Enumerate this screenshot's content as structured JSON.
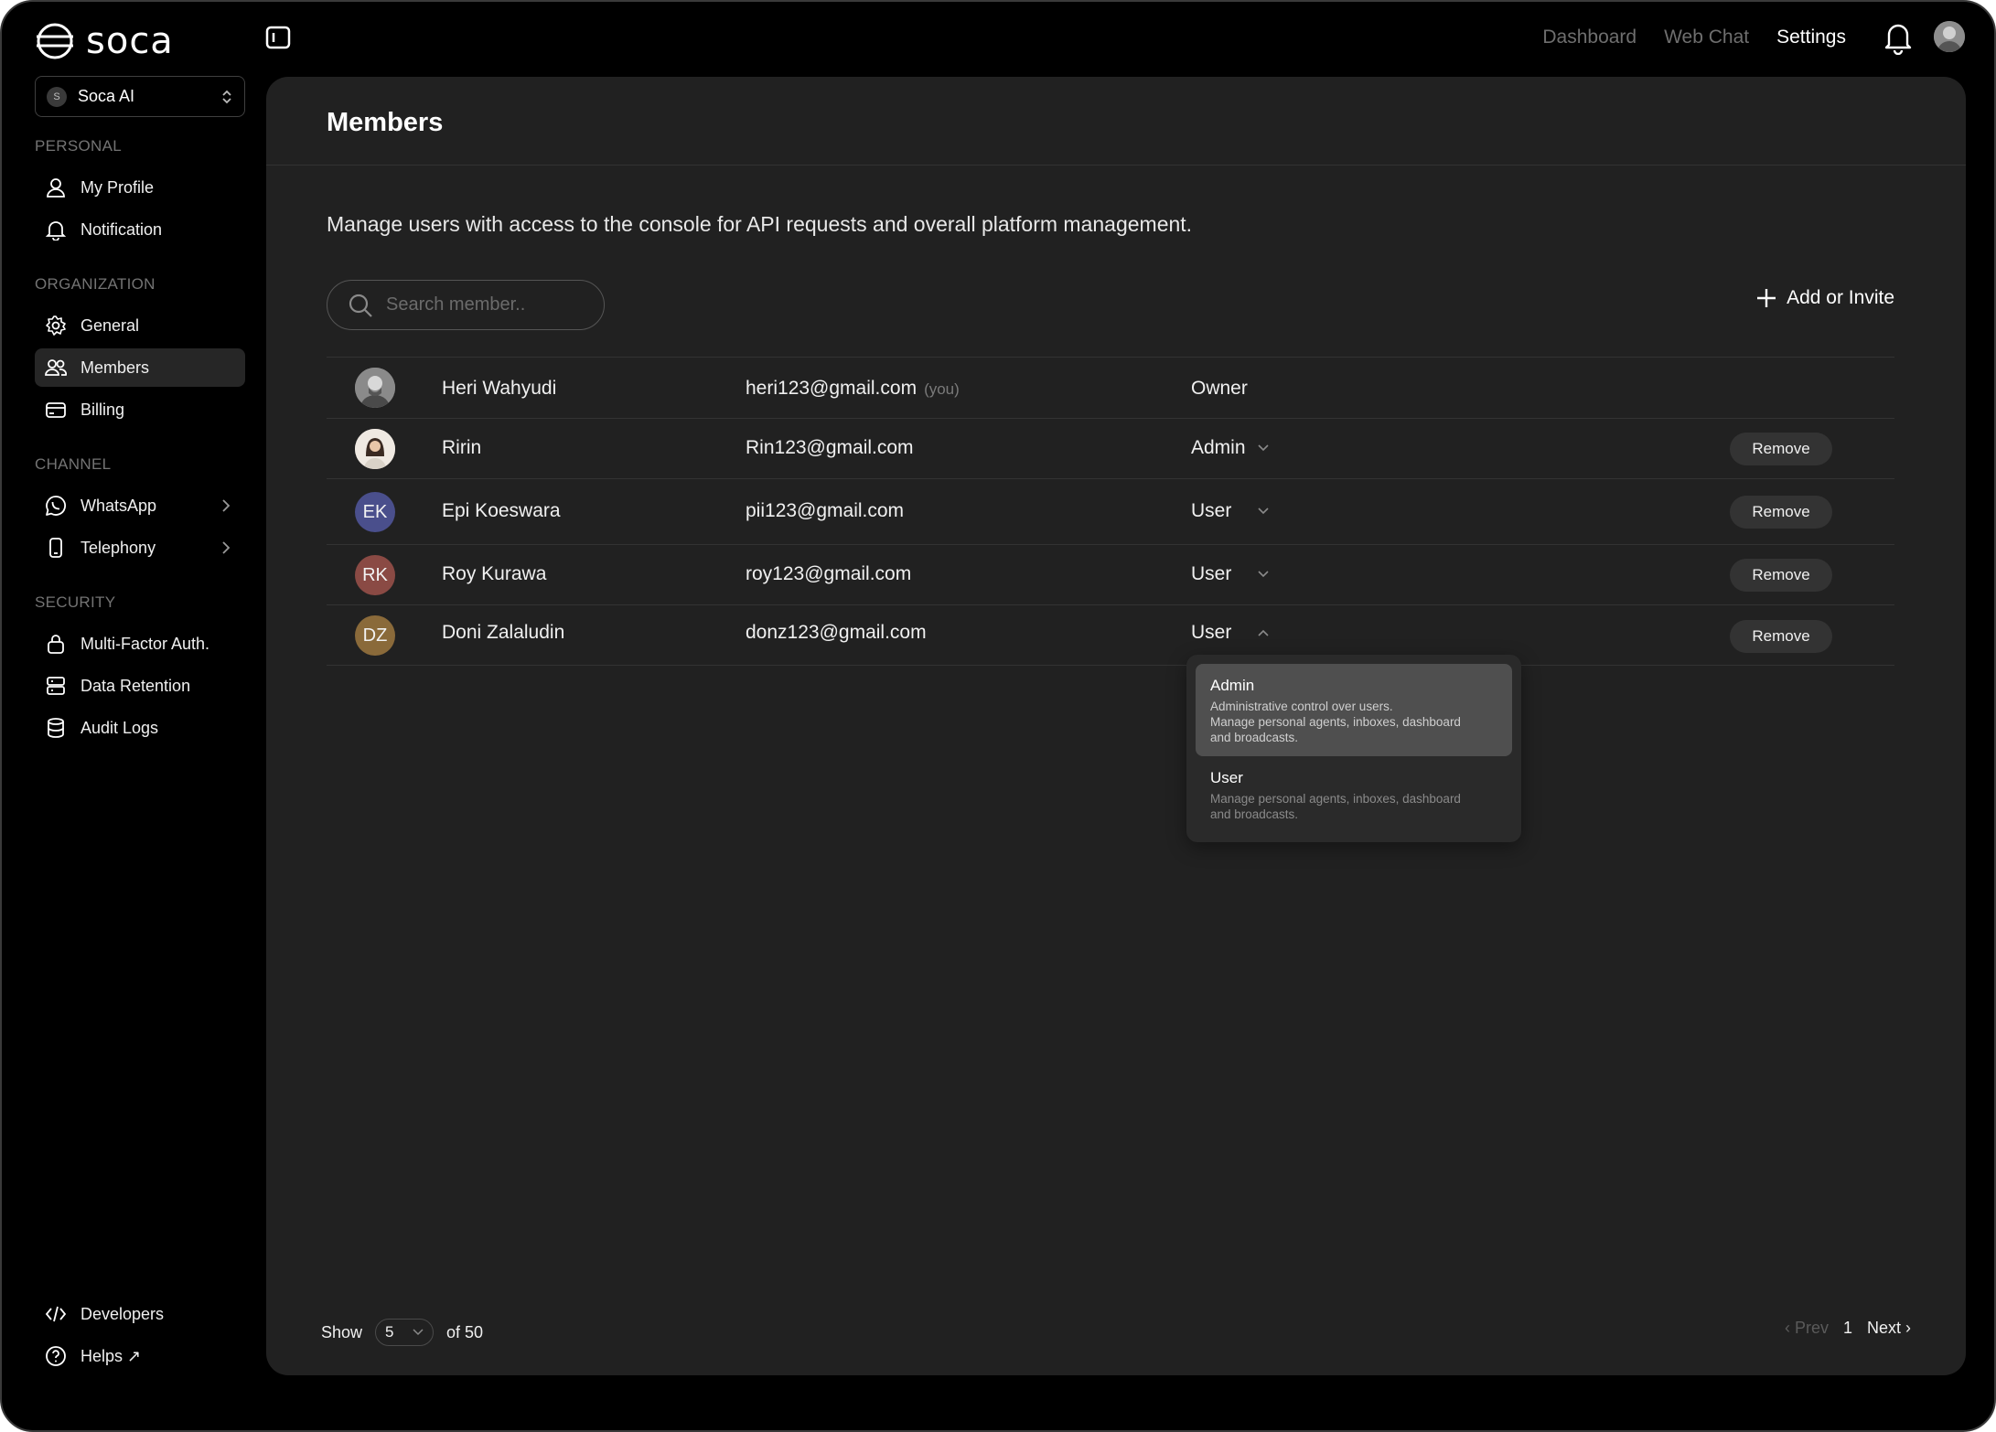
{
  "app": {
    "logo_text": "soca"
  },
  "topnav": {
    "dashboard": "Dashboard",
    "web_chat": "Web Chat",
    "settings": "Settings"
  },
  "org": {
    "badge": "S",
    "name": "Soca AI"
  },
  "sidebar": {
    "personal_label": "PERSONAL",
    "my_profile": "My Profile",
    "notification": "Notification",
    "organization_label": "ORGANIZATION",
    "general": "General",
    "members": "Members",
    "billing": "Billing",
    "channel_label": "CHANNEL",
    "whatsapp": "WhatsApp",
    "telephony": "Telephony",
    "security_label": "SECURITY",
    "mfa": "Multi-Factor Auth.",
    "data_retention": "Data Retention",
    "audit_logs": "Audit Logs",
    "developers": "Developers",
    "helps": "Helps ↗"
  },
  "main": {
    "title": "Members",
    "description": "Manage users with access to the console for API requests and overall platform management.",
    "search_placeholder": "Search member..",
    "add_invite": "Add or Invite",
    "remove_label": "Remove",
    "you_tag": "(you)"
  },
  "members": [
    {
      "initials": "",
      "name": "Heri Wahyudi",
      "email": "heri123@gmail.com",
      "role": "Owner"
    },
    {
      "initials": "",
      "name": "Ririn",
      "email": "Rin123@gmail.com",
      "role": "Admin"
    },
    {
      "initials": "EK",
      "name": "Epi Koeswara",
      "email": "pii123@gmail.com",
      "role": "User"
    },
    {
      "initials": "RK",
      "name": "Roy Kurawa",
      "email": "roy123@gmail.com",
      "role": "User"
    },
    {
      "initials": "DZ",
      "name": "Doni Zalaludin",
      "email": "donz123@gmail.com",
      "role": "User"
    }
  ],
  "role_dropdown": {
    "options": [
      {
        "title": "Admin",
        "desc1": "Administrative control over users.",
        "desc2": "Manage personal agents, inboxes, dashboard",
        "desc3": "and broadcasts."
      },
      {
        "title": "User",
        "desc1": "Manage personal agents, inboxes, dashboard",
        "desc2": "and broadcasts."
      }
    ]
  },
  "footer": {
    "show_label": "Show",
    "page_size": "5",
    "of_total": "of 50",
    "prev": "‹ Prev",
    "page": "1",
    "next": "Next ›"
  },
  "colors": {
    "avatar_ek": "#4a4f8c",
    "avatar_rk": "#8a4a44",
    "avatar_dz": "#8a6a3a"
  }
}
